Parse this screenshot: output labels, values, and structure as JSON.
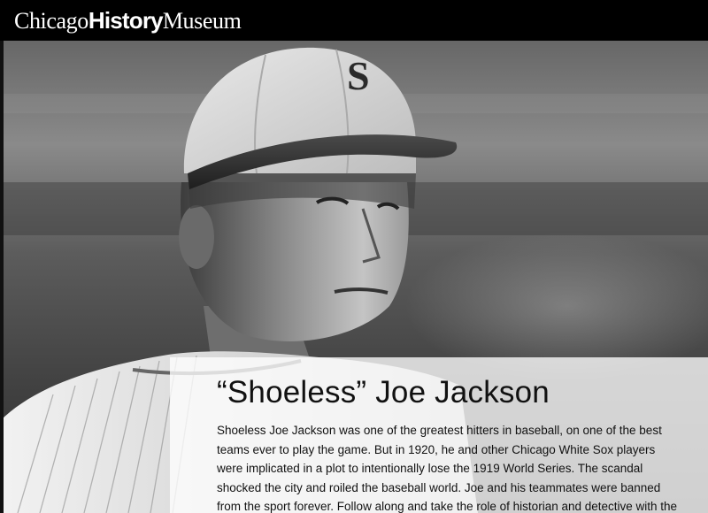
{
  "header": {
    "logo": {
      "word1": "Chicago",
      "word2": "History",
      "word3": "Museum"
    }
  },
  "hero": {
    "image_icon": "photo-of-baseball-player",
    "cap_letter": "S"
  },
  "caption": {
    "title": "“Shoeless” Joe Jackson",
    "body": "Shoeless Joe Jackson was one of the greatest hitters in baseball, on one of the best teams ever to play the game. But in 1920, he and other Chicago White Sox players were implicated in a plot to intentionally lose the 1919 World Series. The scandal shocked the city and roiled the baseball world. Joe and his teammates were banned from the sport forever. Follow along and take the role of historian and detective with the"
  },
  "colors": {
    "header_bg": "#000000",
    "logo_text": "#ffffff",
    "caption_bg": "rgba(255,255,255,0.78)",
    "caption_text": "#111111"
  }
}
